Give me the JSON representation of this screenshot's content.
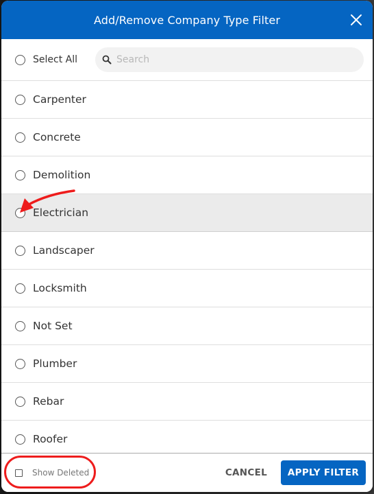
{
  "dialog": {
    "title": "Add/Remove Company Type Filter",
    "close_icon": "close-x-icon",
    "header_color": "#0565c2"
  },
  "toolbar": {
    "select_all_label": "Select All",
    "select_all_checked": false,
    "search": {
      "icon": "search-icon",
      "placeholder": "Search",
      "value": ""
    }
  },
  "items": [
    {
      "label": "Carpenter",
      "selected": false
    },
    {
      "label": "Concrete",
      "selected": false
    },
    {
      "label": "Demolition",
      "selected": false
    },
    {
      "label": "Electrician",
      "selected": false,
      "hovered": true
    },
    {
      "label": "Landscaper",
      "selected": false
    },
    {
      "label": "Locksmith",
      "selected": false
    },
    {
      "label": "Not Set",
      "selected": false
    },
    {
      "label": "Plumber",
      "selected": false
    },
    {
      "label": "Rebar",
      "selected": false
    },
    {
      "label": "Roofer",
      "selected": false
    }
  ],
  "footer": {
    "show_deleted_label": "Show Deleted",
    "show_deleted_checked": false,
    "cancel_label": "CANCEL",
    "apply_label": "APPLY FILTER"
  },
  "annotations": {
    "color": "#ee1c1c",
    "arrow_target": "Electrician radio button",
    "ellipse_target": "Show Deleted checkbox"
  }
}
